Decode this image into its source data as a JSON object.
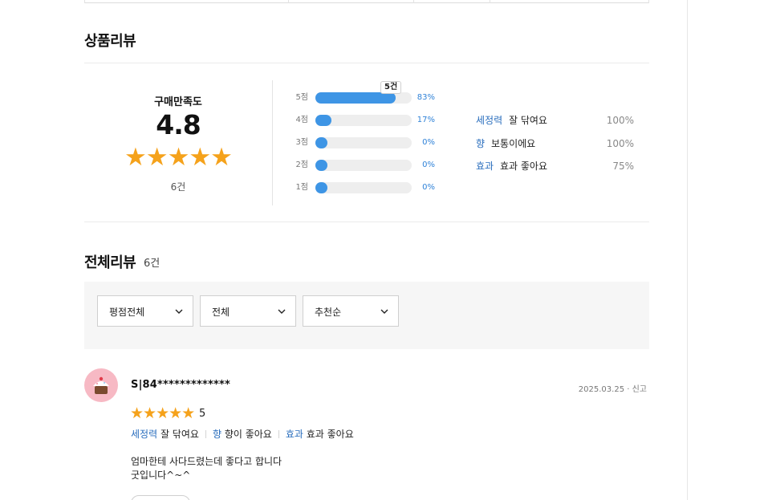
{
  "review_section": {
    "title": "상품리뷰",
    "satisfaction_label": "구매만족도",
    "score": "4.8",
    "stars": "★★★★★",
    "count": "6건",
    "tooltip": "5건",
    "bars": [
      {
        "label": "5점",
        "percent": "83%",
        "fraction": 0.83
      },
      {
        "label": "4점",
        "percent": "17%",
        "fraction": 0.17
      },
      {
        "label": "3점",
        "percent": "0%",
        "fraction": 0
      },
      {
        "label": "2점",
        "percent": "0%",
        "fraction": 0
      },
      {
        "label": "1점",
        "percent": "0%",
        "fraction": 0
      }
    ],
    "attributes": [
      {
        "name": "세정력",
        "value": "잘 닦여요",
        "percent": "100%"
      },
      {
        "name": "향",
        "value": "보통이에요",
        "percent": "100%"
      },
      {
        "name": "효과",
        "value": "효과 좋아요",
        "percent": "75%"
      }
    ]
  },
  "all_reviews": {
    "title": "전체리뷰",
    "count": "6건",
    "filters": [
      {
        "label": "평점전체"
      },
      {
        "label": "전체"
      },
      {
        "label": "추천순"
      }
    ],
    "items": [
      {
        "reviewer": "S|84*************",
        "date": "2025.03.25 · 신고",
        "stars": "★★★★★",
        "score": "5",
        "tags": [
          {
            "key": "세정력",
            "value": "잘 닦여요"
          },
          {
            "key": "향",
            "value": "향이 좋아요"
          },
          {
            "key": "효과",
            "value": "효과 좋아요"
          }
        ],
        "text_line1": "엄마한테 사다드렸는데 좋다고 합니다",
        "text_line2": "굿입니다^~^"
      }
    ]
  },
  "colors": {
    "star": "#f5a21b",
    "bar": "#3e95e5",
    "link_blue": "#2a6ebd",
    "avatar_bg": "#f7b9c4"
  },
  "icons": {
    "dropdown": "chevron-down-icon",
    "avatar": "cupcake-icon"
  }
}
